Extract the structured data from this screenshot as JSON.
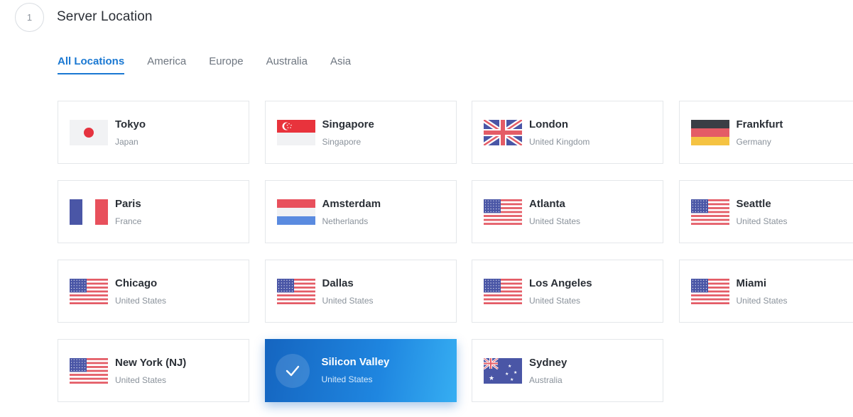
{
  "step": {
    "number": "1",
    "title": "Server Location"
  },
  "tabs": [
    "All Locations",
    "America",
    "Europe",
    "Australia",
    "Asia"
  ],
  "active_tab": "All Locations",
  "colors": {
    "accent": "#1a78d2",
    "selected_start": "#1565c0",
    "selected_end": "#36aef2"
  },
  "locations": [
    {
      "city": "Tokyo",
      "country": "Japan",
      "flag": "japan"
    },
    {
      "city": "Singapore",
      "country": "Singapore",
      "flag": "singapore"
    },
    {
      "city": "London",
      "country": "United Kingdom",
      "flag": "uk"
    },
    {
      "city": "Frankfurt",
      "country": "Germany",
      "flag": "germany"
    },
    {
      "city": "Paris",
      "country": "France",
      "flag": "france"
    },
    {
      "city": "Amsterdam",
      "country": "Netherlands",
      "flag": "netherlands"
    },
    {
      "city": "Atlanta",
      "country": "United States",
      "flag": "usa"
    },
    {
      "city": "Seattle",
      "country": "United States",
      "flag": "usa"
    },
    {
      "city": "Chicago",
      "country": "United States",
      "flag": "usa"
    },
    {
      "city": "Dallas",
      "country": "United States",
      "flag": "usa"
    },
    {
      "city": "Los Angeles",
      "country": "United States",
      "flag": "usa"
    },
    {
      "city": "Miami",
      "country": "United States",
      "flag": "usa"
    },
    {
      "city": "New York (NJ)",
      "country": "United States",
      "flag": "usa"
    },
    {
      "city": "Silicon Valley",
      "country": "United States",
      "flag": "usa",
      "selected": true
    },
    {
      "city": "Sydney",
      "country": "Australia",
      "flag": "australia"
    }
  ]
}
